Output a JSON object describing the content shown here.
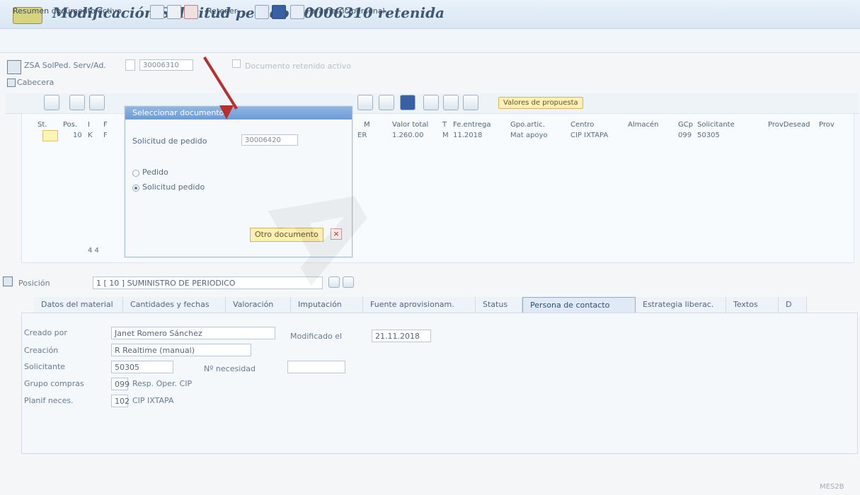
{
  "window": {
    "title": "Modificación Solicitud pedido 30006310 retenida"
  },
  "toolbar": {
    "summary_label": "Resumen documento activo",
    "retener_label": "Retener",
    "personal_label": "Parametric personal"
  },
  "header": {
    "doc_type": "ZSA SolPed. Serv/Ad.",
    "doc_number": "30006310",
    "hold_text": "Documento retenido activo",
    "section_label": "Cabecera"
  },
  "grid": {
    "toolbar_btn": "Valores de propuesta",
    "columns": [
      "St.",
      "Pos.",
      "I",
      "F",
      "M",
      "Valor total",
      "T",
      "Fe.entrega",
      "Gpo.artic.",
      "Centro",
      "Almacén",
      "GCp",
      "Solicitante",
      "ProvDesead",
      "Prov"
    ],
    "row": {
      "pos": "10",
      "i": "K",
      "f": "F",
      "m": "ER",
      "valor_total": "1.260.00",
      "t": "M",
      "fe_entrega": "11.2018",
      "gpo_artic": "Mat apoyo",
      "centro": "CIP IXTAPA",
      "gcp": "099",
      "solicitante": "50305"
    },
    "scroll_label": "4 4"
  },
  "dialog": {
    "title": "Seleccionar documento",
    "field_label": "Solicitud de pedido",
    "field_value": "30006420",
    "option_1": "Pedido",
    "option_2": "Solicitud pedido",
    "button_label": "Otro documento"
  },
  "position": {
    "label": "Posición",
    "item_text": "1 [ 10 ] SUMINISTRO DE PERIODICO"
  },
  "tabs": [
    "Datos del material",
    "Cantidades y fechas",
    "Valoración",
    "Imputación",
    "Fuente aprovisionam.",
    "Status",
    "Persona de contacto",
    "Estrategia liberac.",
    "Textos",
    "D"
  ],
  "details": {
    "created_by_label": "Creado por",
    "created_by_value": "Janet Romero Sánchez",
    "modified_label": "Modificado el",
    "modified_value": "21.11.2018",
    "creation_label": "Creación",
    "creation_value": "R Realtime (manual)",
    "requester_label": "Solicitante",
    "requester_value": "50305",
    "need_number_label": "Nº necesidad",
    "purchase_group_label": "Grupo compras",
    "purchase_group_code": "099",
    "purchase_group_text": "Resp. Oper. CIP",
    "planning_label": "Planif neces.",
    "planning_code": "102",
    "planning_text": "CIP IXTAPA"
  },
  "footer": {
    "status_text": "MES2B"
  }
}
